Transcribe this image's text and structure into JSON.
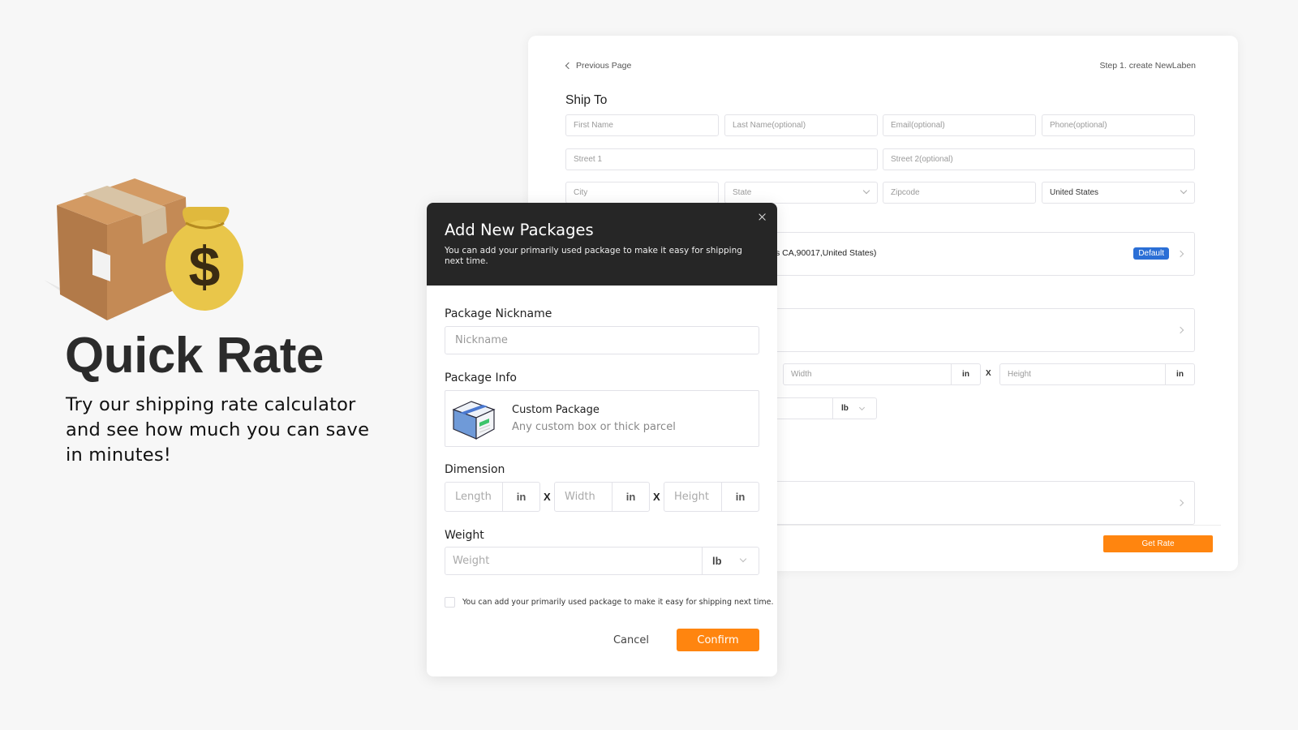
{
  "hero": {
    "title": "Quick Rate",
    "subtitle": "Try our shipping rate calculator and see how much you can save in minutes!",
    "art_icons": [
      "package-box-icon",
      "money-bag-icon"
    ]
  },
  "page": {
    "prev_link": "Previous Page",
    "step": "Step 1. create NewLaben",
    "ship_to_title": "Ship To",
    "fields": {
      "first_name": "First Name",
      "last_name": "Last Name(optional)",
      "email": "Email(optional)",
      "phone": "Phone(optional)",
      "street1": "Street 1",
      "street2": "Street 2(optional)",
      "city": "City",
      "state": "State",
      "zipcode": "Zipcode",
      "country": "United States"
    },
    "address_snippet": "s CA,90017,United States)",
    "default_badge": "Default",
    "width_placeholder": "Width",
    "height_placeholder": "Height",
    "unit_in": "in",
    "times": "X",
    "weight_unit": "lb",
    "get_rate": "Get Rate"
  },
  "modal": {
    "title": "Add New Packages",
    "description": "You can add your primarily used package to make it easy for shipping next time.",
    "nickname_label": "Package Nickname",
    "nickname_placeholder": "Nickname",
    "package_info_label": "Package Info",
    "package_name": "Custom Package",
    "package_desc": "Any custom box or thick parcel",
    "dimension_label": "Dimension",
    "length_placeholder": "Length",
    "width_placeholder": "Width",
    "height_placeholder": "Height",
    "unit_in": "in",
    "times": "X",
    "weight_label": "Weight",
    "weight_placeholder": "Weight",
    "weight_unit": "lb",
    "save_checkbox_text": "You can add your primarily used package to make it easy for shipping next time.",
    "save_checked": false,
    "cancel": "Cancel",
    "confirm": "Confirm"
  },
  "colors": {
    "accent_orange": "#ff850f",
    "badge_blue": "#2b6fd6",
    "modal_header": "#262626"
  }
}
